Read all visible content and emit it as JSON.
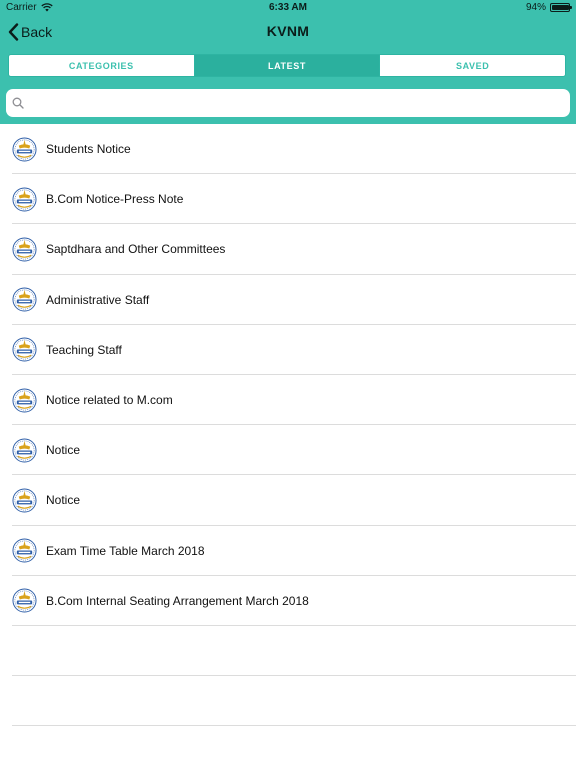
{
  "status_bar": {
    "carrier": "Carrier",
    "time": "6:33 AM",
    "battery_text": "94%",
    "battery_level": 0.94
  },
  "nav": {
    "back_label": "Back",
    "title": "KVNM"
  },
  "tabs": [
    {
      "label": "CATEGORIES",
      "active": false
    },
    {
      "label": "LATEST",
      "active": true
    },
    {
      "label": "SAVED",
      "active": false
    }
  ],
  "search": {
    "placeholder": "",
    "value": ""
  },
  "notices": [
    {
      "title": "Students Notice"
    },
    {
      "title": "B.Com Notice-Press Note"
    },
    {
      "title": "Saptdhara and Other Committees"
    },
    {
      "title": "Administrative Staff"
    },
    {
      "title": "Teaching Staff"
    },
    {
      "title": "Notice related to M.com"
    },
    {
      "title": "Notice"
    },
    {
      "title": "Notice"
    },
    {
      "title": "Exam Time Table March 2018"
    },
    {
      "title": "B.Com Internal Seating Arrangement March 2018"
    }
  ],
  "colors": {
    "accent": "#3cc0ae",
    "accent_dark": "#2bb09e",
    "logo_gold": "#d9a21b",
    "logo_blue": "#2f5fa8"
  }
}
